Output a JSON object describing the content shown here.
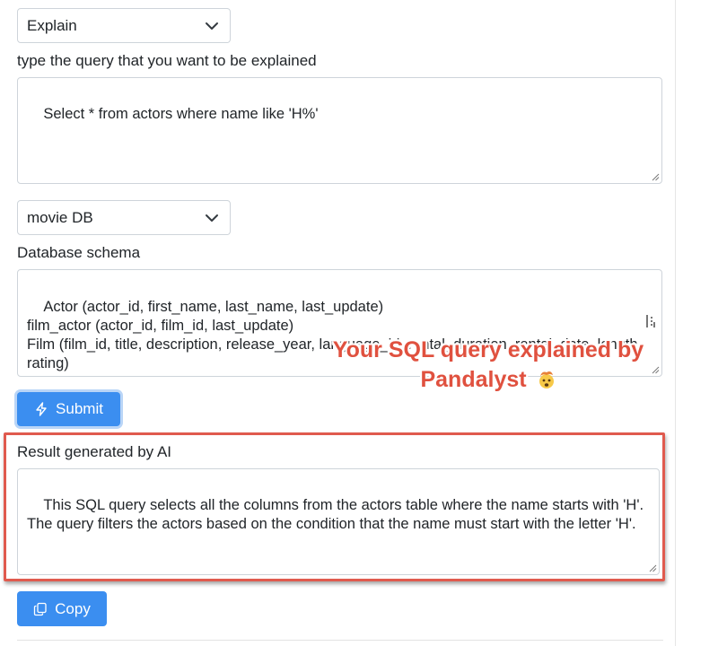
{
  "mode_select": {
    "value": "Explain"
  },
  "query_label": "type the query that you want to be explained",
  "query_input": {
    "value": "Select * from actors where name like 'H%'"
  },
  "db_select": {
    "value": "movie DB"
  },
  "schema_label": "Database schema",
  "schema_input": {
    "value": "Actor (actor_id, first_name, last_name, last_update)\nfilm_actor (actor_id, film_id, last_update)\nFilm (film_id, title, description, release_year, language_id, rental_duration, rental_date, length, rating)\nLanguage (language_id, name, last_update)"
  },
  "submit_button": {
    "label": "Submit"
  },
  "result_label": "Result generated by AI",
  "result_output": {
    "value": "This SQL query selects all the columns from the actors table where the name starts with 'H'. The query filters the actors based on the condition that the name must start with the letter 'H'."
  },
  "copy_button": {
    "label": "Copy"
  },
  "annotation": {
    "line1": "Your SQL query explained by",
    "line2": "Pandalyst"
  },
  "icons": {
    "select_caret": "chevron-down-icon",
    "submit": "lightning-bolt-icon",
    "copy": "copy-icon",
    "emoji": "exploding-head-emoji"
  },
  "colors": {
    "primary": "#3b8ef0",
    "highlight": "#e05a4e",
    "annotation": "#e0513f"
  }
}
